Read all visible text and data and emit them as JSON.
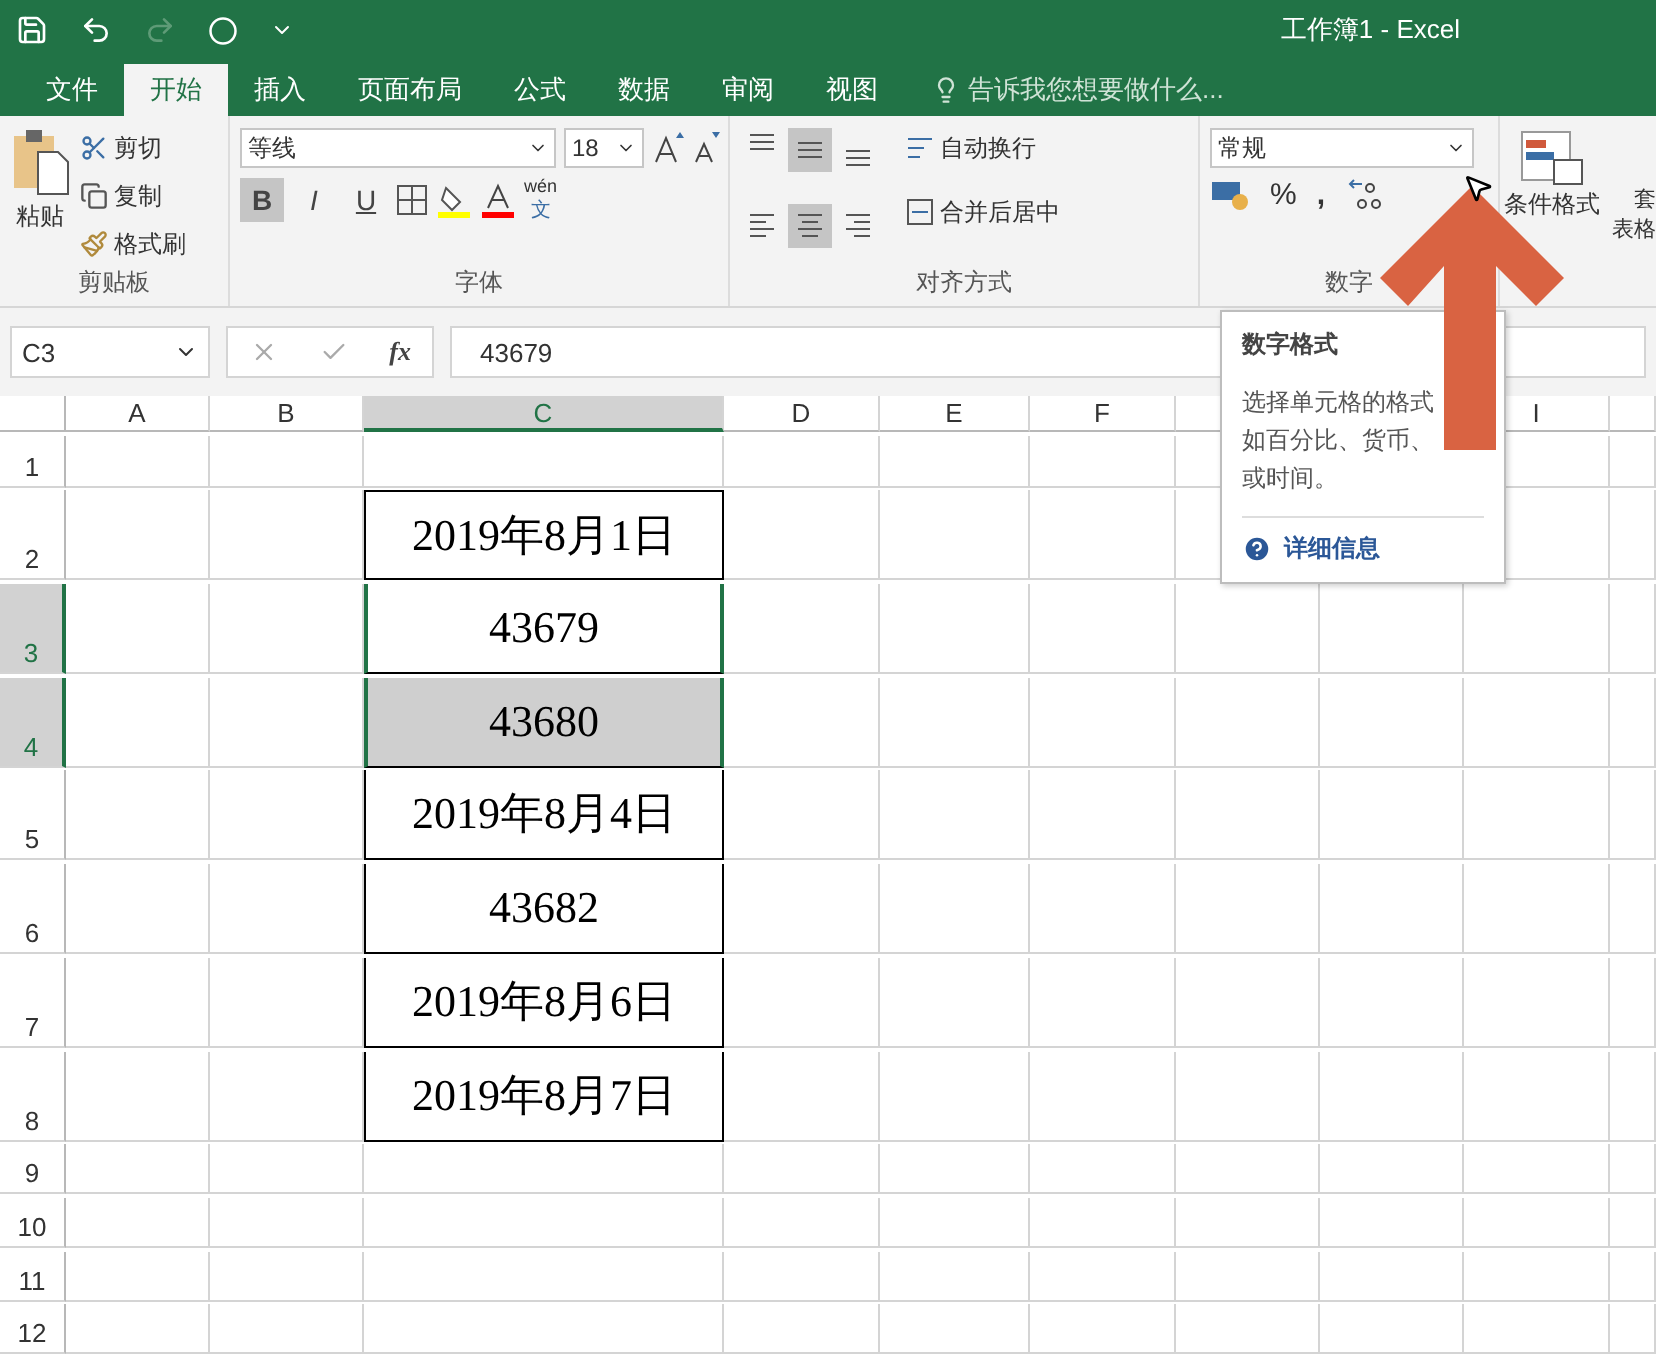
{
  "title_bar": {
    "title": "工作簿1 - Excel"
  },
  "tabs": [
    {
      "label": "文件",
      "selected": false
    },
    {
      "label": "开始",
      "selected": true
    },
    {
      "label": "插入",
      "selected": false
    },
    {
      "label": "页面布局",
      "selected": false
    },
    {
      "label": "公式",
      "selected": false
    },
    {
      "label": "数据",
      "selected": false
    },
    {
      "label": "审阅",
      "selected": false
    },
    {
      "label": "视图",
      "selected": false
    }
  ],
  "tell_me": {
    "placeholder": "告诉我您想要做什么..."
  },
  "clipboard": {
    "paste": "粘贴",
    "cut": "剪切",
    "copy": "复制",
    "painter": "格式刷",
    "label": "剪贴板"
  },
  "font": {
    "name": "等线",
    "size": "18",
    "styles": [
      {
        "label": "B",
        "selected": true
      },
      {
        "label": "I",
        "selected": false
      },
      {
        "label": "U",
        "selected": false
      }
    ],
    "phonetic_top": "wén",
    "phonetic_bottom": "文",
    "label": "字体"
  },
  "alignment": {
    "buttons": [
      {
        "kind": "top",
        "selected": false
      },
      {
        "kind": "middle",
        "selected": true
      },
      {
        "kind": "bottom",
        "selected": false
      },
      {
        "kind": "left",
        "selected": false
      },
      {
        "kind": "center",
        "selected": true
      },
      {
        "kind": "right",
        "selected": false
      }
    ],
    "wrap": "自动换行",
    "merge": "合并后居中",
    "label": "对齐方式"
  },
  "number": {
    "format": "常规",
    "percent": "%",
    "comma": ",",
    "label": "数字"
  },
  "styles": {
    "conditional": "条件格式",
    "table_top": "套",
    "table_bottom": "表格"
  },
  "name_box": {
    "value": "C3"
  },
  "formula": {
    "fx": "fx",
    "value": "43679"
  },
  "columns": [
    {
      "label": "A",
      "selected": false
    },
    {
      "label": "B",
      "selected": false
    },
    {
      "label": "C",
      "selected": true
    },
    {
      "label": "D",
      "selected": false
    },
    {
      "label": "E",
      "selected": false
    },
    {
      "label": "F",
      "selected": false
    },
    {
      "selected": false
    },
    {},
    {
      "label": "I",
      "selected": false
    },
    {
      "selected": false
    }
  ],
  "rows": [
    {
      "header": "1",
      "selected": false
    },
    {
      "header": "2",
      "selected": false,
      "value": "2019年8月1日",
      "highlighted": false
    },
    {
      "header": "3",
      "selected": true,
      "value": "43679",
      "highlighted": false
    },
    {
      "header": "4",
      "selected": true,
      "value": "43680",
      "highlighted": true
    },
    {
      "header": "5",
      "selected": false,
      "value": "2019年8月4日",
      "highlighted": false
    },
    {
      "header": "6",
      "selected": false,
      "value": "43682",
      "highlighted": false
    },
    {
      "header": "7",
      "selected": false,
      "value": "2019年8月6日",
      "highlighted": false
    },
    {
      "header": "8",
      "selected": false,
      "value": "2019年8月7日",
      "highlighted": false
    },
    {
      "header": "9",
      "selected": false
    },
    {
      "header": "10",
      "selected": false
    },
    {
      "header": "11",
      "selected": false
    },
    {
      "header": "12",
      "selected": false
    }
  ],
  "tooltip": {
    "title": "数字格式",
    "lines": [
      "选择单元格的格式",
      "如百分比、货币、",
      "或时间。"
    ],
    "link": "详细信息"
  }
}
